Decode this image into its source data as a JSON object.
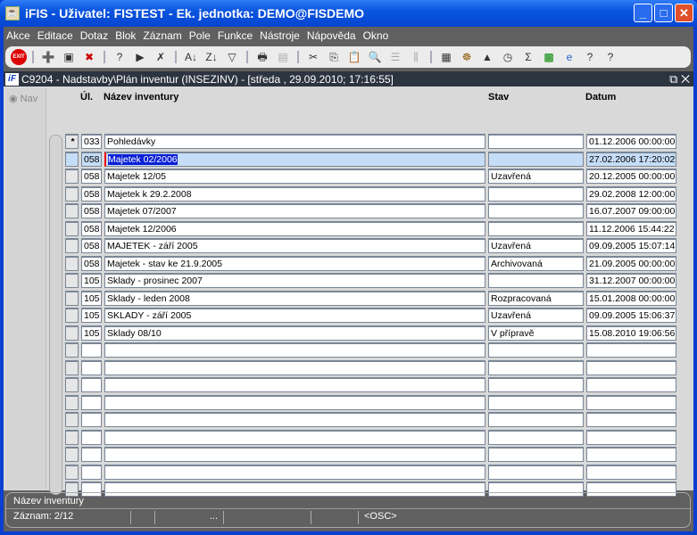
{
  "window": {
    "title": "iFIS - Uživatel: FISTEST - Ek. jednotka: DEMO@FISDEMO"
  },
  "menu": [
    "Akce",
    "Editace",
    "Dotaz",
    "Blok",
    "Záznam",
    "Pole",
    "Funkce",
    "Nástroje",
    "Nápověda",
    "Okno"
  ],
  "toolbar": {
    "exit": "EXIT"
  },
  "form": {
    "title": "C9204 - Nadstavby\\Plán inventur (INSEZINV) - [středa , 29.09.2010; 17:16:55]",
    "nav_label": "Nav",
    "headers": {
      "ul": "Úl.",
      "name": "Název inventury",
      "stav": "Stav",
      "datum": "Datum"
    },
    "rows": [
      {
        "ind": "*",
        "ul": "033",
        "name": "Pohledávky",
        "stav": "",
        "datum": "01.12.2006 00:00:00"
      },
      {
        "ind": "",
        "ul": "058",
        "name": "Majetek 02/2006",
        "stav": "",
        "datum": "27.02.2006 17:20:02"
      },
      {
        "ind": "",
        "ul": "058",
        "name": "Majetek 12/05",
        "stav": "Uzavřená",
        "datum": "20.12.2005 00:00:00"
      },
      {
        "ind": "",
        "ul": "058",
        "name": "Majetek k 29.2.2008",
        "stav": "",
        "datum": "29.02.2008 12:00:00"
      },
      {
        "ind": "",
        "ul": "058",
        "name": "Majetek 07/2007",
        "stav": "",
        "datum": "16.07.2007 09:00:00"
      },
      {
        "ind": "",
        "ul": "058",
        "name": "Majetek 12/2006",
        "stav": "",
        "datum": "11.12.2006 15:44:22"
      },
      {
        "ind": "",
        "ul": "058",
        "name": "MAJETEK - září 2005",
        "stav": "Uzavřená",
        "datum": "09.09.2005 15:07:14"
      },
      {
        "ind": "",
        "ul": "058",
        "name": "Majetek - stav ke 21.9.2005",
        "stav": "Archivovaná",
        "datum": "21.09.2005 00:00:00"
      },
      {
        "ind": "",
        "ul": "105",
        "name": "Sklady - prosinec 2007",
        "stav": "",
        "datum": "31.12.2007 00:00:00"
      },
      {
        "ind": "",
        "ul": "105",
        "name": "Sklady - leden 2008",
        "stav": "Rozpracovaná",
        "datum": "15.01.2008 00:00:00"
      },
      {
        "ind": "",
        "ul": "105",
        "name": "SKLADY - září 2005",
        "stav": "Uzavřená",
        "datum": "09.09.2005 15:06:37"
      },
      {
        "ind": "",
        "ul": "105",
        "name": "Sklady 08/10",
        "stav": "V přípravě",
        "datum": "15.08.2010 19:06:56"
      }
    ]
  },
  "status": {
    "field": "Název inventury",
    "record": "Záznam: 2/12",
    "dots": "...",
    "mode": "<OSC>"
  }
}
